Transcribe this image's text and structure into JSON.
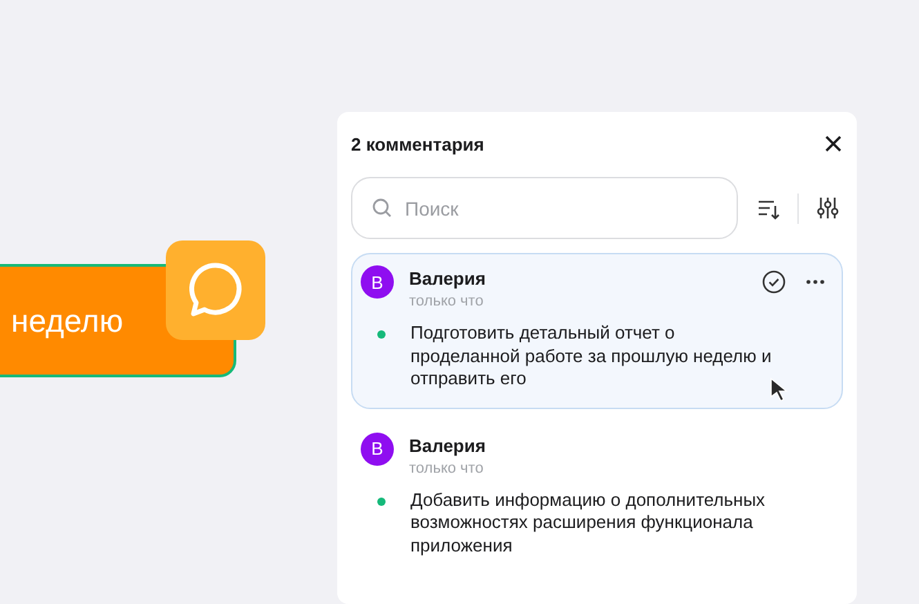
{
  "canvas": {
    "highlight": {
      "text": "неделю"
    }
  },
  "panel": {
    "title": "2 комментария",
    "search": {
      "placeholder": "Поиск"
    },
    "comments": [
      {
        "author": "Валерия",
        "initial": "В",
        "time": "только что",
        "text": "Подготовить детальный отчет о проделанной работе за прошлую неделю и отправить его",
        "selected": true
      },
      {
        "author": "Валерия",
        "initial": "В",
        "time": "только что",
        "text": "Добавить информацию о дополнительных возможностях расширения функционала приложения",
        "selected": false
      }
    ]
  }
}
